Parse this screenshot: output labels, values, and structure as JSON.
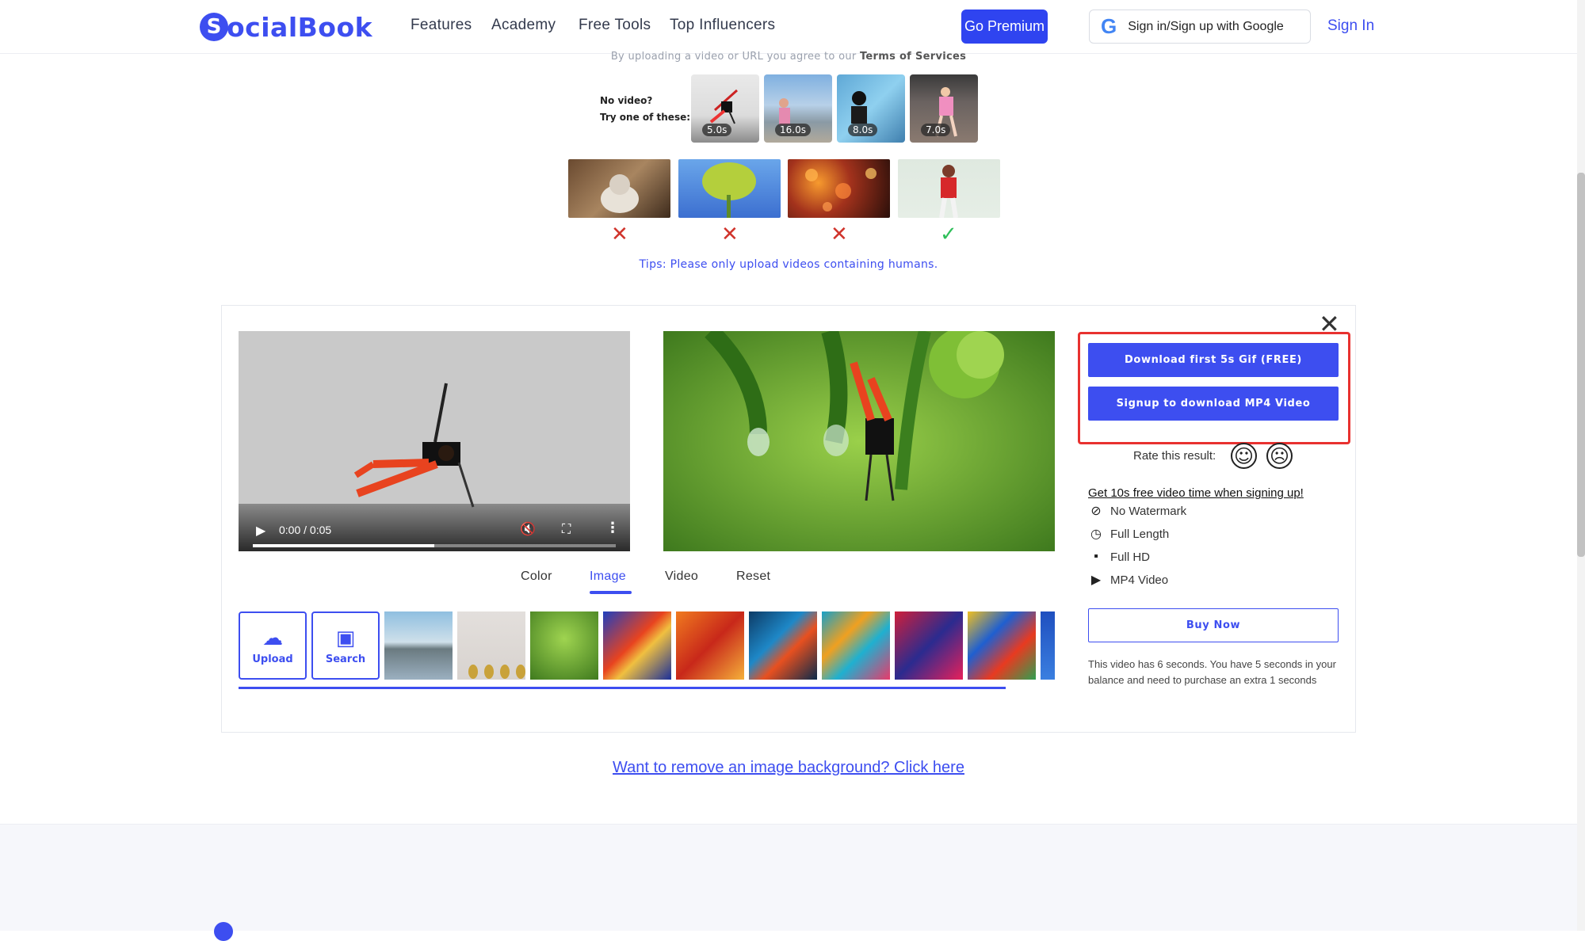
{
  "header": {
    "logo_letter": "S",
    "logo_word": "ocialBook",
    "nav": [
      "Features",
      "Academy",
      "Free Tools",
      "Top Influencers"
    ],
    "premium_label": "Go Premium",
    "google_label": "Sign in/Sign up with Google",
    "signin_label": "Sign In"
  },
  "terms": {
    "prefix": "By uploading a video or URL you agree to our",
    "link": "Terms of Services"
  },
  "samples": {
    "prompt_line1": "No video?",
    "prompt_line2": "Try one of these:",
    "durations": [
      "5.0s",
      "16.0s",
      "8.0s",
      "7.0s"
    ]
  },
  "examples": {
    "marks": [
      "✕",
      "✕",
      "✕",
      "✓"
    ],
    "tips": "Tips: Please only upload videos containing humans."
  },
  "player": {
    "time": "0:00 / 0:05",
    "progress": 0.5
  },
  "tabs": [
    "Color",
    "Image",
    "Video",
    "Reset"
  ],
  "active_tab": "Image",
  "tools": {
    "upload": "Upload",
    "search": "Search"
  },
  "actions": {
    "download_gif": "Download first 5s Gif (FREE)",
    "signup_mp4": "Signup to download MP4 Video",
    "rate_label": "Rate this result:",
    "promo": "Get 10s free video time when signing up!",
    "features": [
      "No Watermark",
      "Full Length",
      "Full HD",
      "MP4 Video"
    ],
    "buy_now": "Buy Now",
    "balance_text": "This video has 6 seconds. You have 5 seconds in your balance and need to purchase an extra 1 seconds"
  },
  "remove_bg_link": "Want to remove an image background? Click here",
  "colors": {
    "accent": "#3d4ef0",
    "highlight": "#e8312f",
    "error": "#d0342c",
    "success": "#2fbf5a"
  }
}
